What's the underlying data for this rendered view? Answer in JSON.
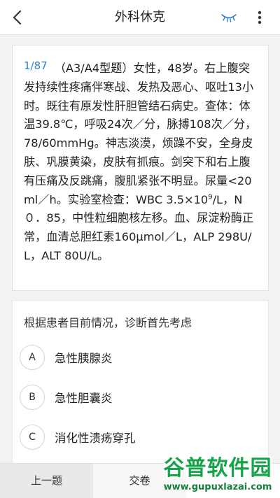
{
  "header": {
    "title": "外科休克",
    "back_icon": "chevron-left-icon",
    "eye_icon": "eye-closed-icon",
    "more_icon": "more-vertical-icon"
  },
  "question": {
    "index": "1/87",
    "stem_part1": "（A3/A4型题）女性，48岁。右上腹突发持续性疼痛伴寒战、发热及恶心、呕吐13小时。既往有原发性肝胆管结石病史。查体：体温39.8℃，呼吸24次／分，脉搏108次／分，78/60mmHg。神志淡漠，烦躁不安，全身皮肤、巩膜黄染，皮肤有抓痕。剑突下和右上腹有压痛及反跳痛，腹肌紧张不明显。尿量<20ml／h。实验室检查：WBC 3.5×10",
    "stem_sup": "9",
    "stem_part2": "/L，N０．85，中性粒细胞核左移。血、尿淀粉酶正常，血清总胆红素160μmol／L，ALP 298U/L，ALT 80U/L。"
  },
  "options": {
    "prompt": "根据患者目前情况，诊断首先考虑",
    "items": [
      {
        "letter": "A",
        "text": "急性胰腺炎"
      },
      {
        "letter": "B",
        "text": "急性胆囊炎"
      },
      {
        "letter": "C",
        "text": "消化性溃疡穿孔"
      }
    ]
  },
  "footer": {
    "prev_label": "上一题",
    "submit_label": "交卷"
  },
  "watermark": {
    "title": "谷普软件园",
    "url": "www.gupuxlazai.com"
  },
  "colors": {
    "accent": "#2f7fd0",
    "watermark": "#16a34a"
  }
}
